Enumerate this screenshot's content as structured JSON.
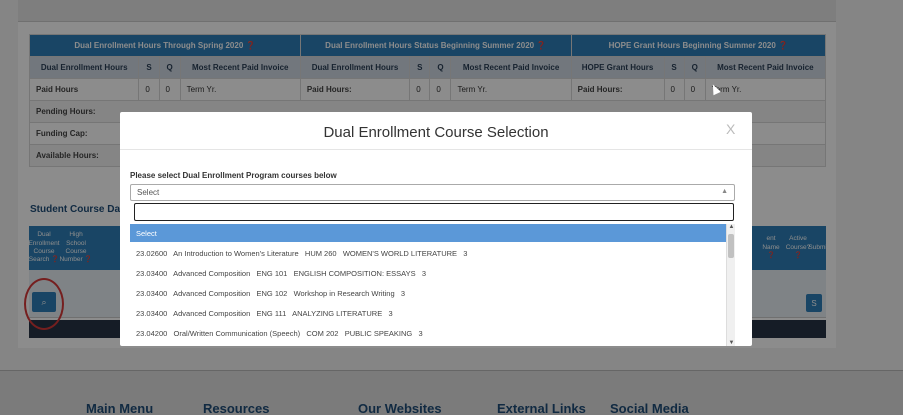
{
  "hours": {
    "headers": [
      "Dual Enrollment Hours Through Spring 2020 ❓",
      "Dual Enrollment Hours Status Beginning Summer 2020 ❓",
      "HOPE Grant Hours Beginning Summer 2020 ❓"
    ],
    "sub": [
      "Dual Enrollment Hours",
      "S",
      "Q",
      "Most Recent Paid Invoice",
      "Dual Enrollment Hours",
      "S",
      "Q",
      "Most Recent Paid Invoice",
      "HOPE Grant Hours",
      "S",
      "Q",
      "Most Recent Paid Invoice"
    ],
    "paid_row": [
      "Paid Hours",
      "0",
      "0",
      "Term Yr.",
      "Paid Hours:",
      "0",
      "0",
      "Term Yr.",
      "Paid Hours:",
      "0",
      "0",
      "Term Yr."
    ],
    "pending": "Pending Hours:",
    "funding": "Funding Cap:",
    "available": "Available Hours:"
  },
  "course_section": {
    "title": "Student Course Data",
    "cols": [
      "Dual Enrollment Course Search ❓",
      "High School Course Number ❓",
      "ent Name ❓",
      "Active Course? ❓",
      "Submit"
    ],
    "search_icon": "⌕",
    "submit_short": "S"
  },
  "footer": {
    "items": [
      "Main Menu",
      "Resources",
      "Our Websites",
      "External Links",
      "Social Media"
    ]
  },
  "modal": {
    "title": "Dual Enrollment Course Selection",
    "close": "X",
    "prompt": "Please select Dual Enrollment Program courses below",
    "select_value": "Select",
    "search_value": "",
    "options": [
      "Select",
      "23.02600   An Introduction to Women's Literature   HUM 260   WOMEN'S WORLD LITERATURE   3",
      "23.03400   Advanced Composition   ENG 101   ENGLISH COMPOSITION: ESSAYS   3",
      "23.03400   Advanced Composition   ENG 102   Workshop in Research Writing   3",
      "23.03400   Advanced Composition   ENG 111   ANALYZING LITERATURE   3",
      "23.04200   Oral/Written Communication (Speech)   COM 202   PUBLIC SPEAKING   3"
    ]
  },
  "colors": {
    "accent": "#2e7fb8",
    "highlight": "#5b98d8",
    "dark": "#273345",
    "annotation": "#d63a3a"
  }
}
